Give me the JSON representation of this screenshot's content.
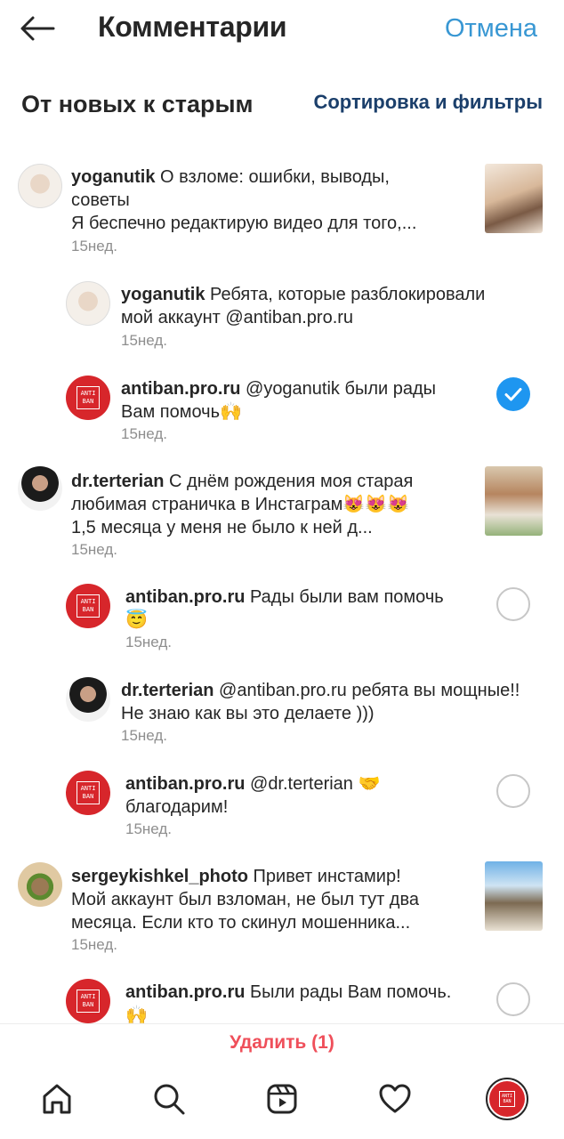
{
  "header": {
    "title": "Комментарии",
    "cancel": "Отмена",
    "back_icon": "arrow-left-icon"
  },
  "sort": {
    "label": "От новых к старым",
    "filter_button": "Сортировка и фильтры"
  },
  "comments": [
    {
      "username": "yoganutik",
      "text_line1": " О взломе: ошибки, выводы,",
      "text_line2": "советы",
      "text_line3": "Я беспечно редактирую видео для того,...",
      "time": "15нед.",
      "selected": false
    },
    {
      "username": "yoganutik",
      "text_line1": " Ребята, которые разблокировали",
      "text_line2": "мой аккаунт @antiban.pro.ru",
      "time": "15нед."
    },
    {
      "username": "antiban.pro.ru",
      "text_line1": " @yoganutik были рады",
      "text_line2": "Вам помочь🙌",
      "time": "15нед.",
      "selected": true
    },
    {
      "username": "dr.terterian",
      "text_line1": " С днём рождения моя старая",
      "text_line2": "любимая страничка в Инстаграм😻😻😻",
      "text_line3": "1,5 месяца у меня не было к ней д...",
      "time": "15нед."
    },
    {
      "username": "antiban.pro.ru",
      "text_line1": " Рады были вам помочь",
      "text_line2": "😇",
      "time": "15нед.",
      "selected": false
    },
    {
      "username": "dr.terterian",
      "text_line1": " @antiban.pro.ru ребята вы мощные!!",
      "text_line2": "Не знаю как вы это делаете )))",
      "time": "15нед."
    },
    {
      "username": "antiban.pro.ru",
      "text_line1": " @dr.terterian 🤝",
      "text_line2": "благодарим!",
      "time": "15нед.",
      "selected": false
    },
    {
      "username": "sergeykishkel_photo",
      "text_line1": " Привет инстамир!",
      "text_line2": "Мой аккаунт был взломан, не был тут два",
      "text_line3": "месяца. Если кто то скинул мошенника...",
      "time": "15нед."
    },
    {
      "username": "antiban.pro.ru",
      "text_line1": " Были рады Вам помочь.",
      "text_line2": "🙌",
      "selected": false
    }
  ],
  "logo_text": "ANTI BAN",
  "actions": {
    "delete": "Удалить (1)"
  },
  "nav": {
    "home_icon": "home-icon",
    "search_icon": "search-icon",
    "reels_icon": "reels-icon",
    "heart_icon": "heart-icon",
    "profile_icon": "profile-avatar-icon"
  },
  "colors": {
    "accent_blue": "#3897d3",
    "check_blue": "#1e96f0",
    "delete_red": "#ef4f5a",
    "brand_red": "#d7262b"
  }
}
